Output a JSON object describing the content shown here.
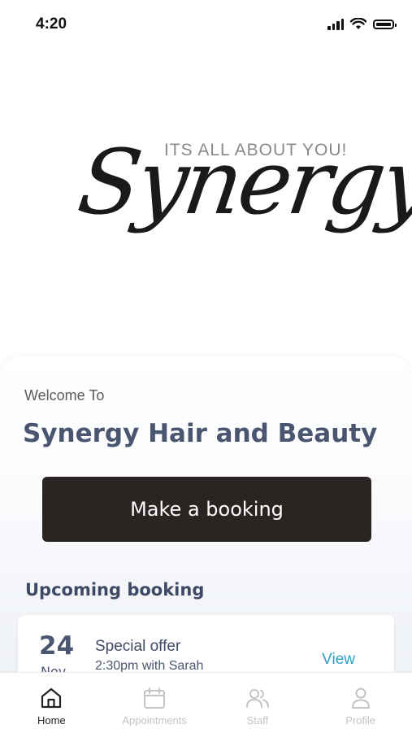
{
  "status_bar": {
    "time": "4:20"
  },
  "logo": {
    "script": "Synergy",
    "tagline": "ITS ALL ABOUT YOU!"
  },
  "welcome": {
    "label": "Welcome To",
    "salon_name": "Synergy Hair and Beauty"
  },
  "booking_button": {
    "label": "Make a booking"
  },
  "upcoming": {
    "heading": "Upcoming booking",
    "card": {
      "day": "24",
      "month": "Nov",
      "title": "Special offer",
      "subtitle": "2:30pm with Sarah",
      "action": "View"
    }
  },
  "tabs": [
    {
      "label": "Home",
      "icon": "home-icon",
      "active": true
    },
    {
      "label": "Appointments",
      "icon": "calendar-icon",
      "active": false
    },
    {
      "label": "Staff",
      "icon": "users-icon",
      "active": false
    },
    {
      "label": "Profile",
      "icon": "person-icon",
      "active": false
    }
  ],
  "colors": {
    "heading": "#4a5670",
    "button_bg": "#2a2422",
    "link": "#2f9ec9",
    "tab_inactive": "#c4c4c4"
  }
}
